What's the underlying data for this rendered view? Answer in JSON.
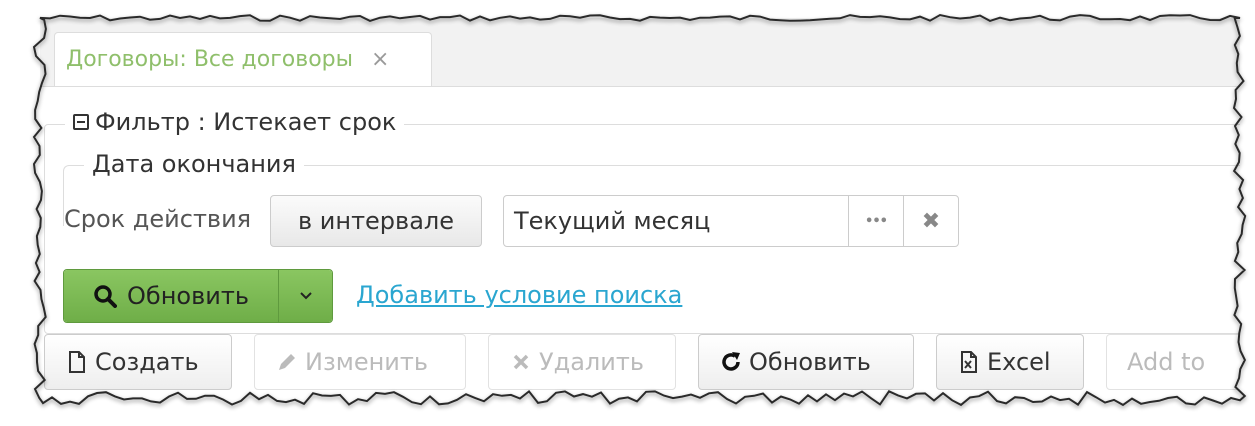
{
  "tab": {
    "title": "Договоры: Все договоры",
    "close_glyph": "×"
  },
  "filter": {
    "legend": "Фильтр : Истекает срок",
    "date_group": {
      "legend": "Дата окончания",
      "field_label": "Срок действия",
      "operator_button": "в интервале",
      "value": "Текущий месяц",
      "more_glyph": "•••",
      "clear_glyph": "✖"
    },
    "refresh_button": "Обновить",
    "add_condition_link": "Добавить условие поиска"
  },
  "toolbar": {
    "create": "Создать",
    "edit": "Изменить",
    "delete": "Удалить",
    "refresh": "Обновить",
    "excel": "Excel",
    "add_to": "Add to"
  },
  "icons": {
    "collapse": "minus-square-icon",
    "search": "search-icon",
    "caret": "chevron-down-icon",
    "create": "file-icon",
    "edit": "pencil-icon",
    "delete": "x-icon",
    "refresh": "refresh-icon",
    "excel": "excel-file-icon"
  },
  "colors": {
    "tab_title": "#8fbf6b",
    "primary_button": "#7ab752",
    "link": "#2aa6d0"
  }
}
